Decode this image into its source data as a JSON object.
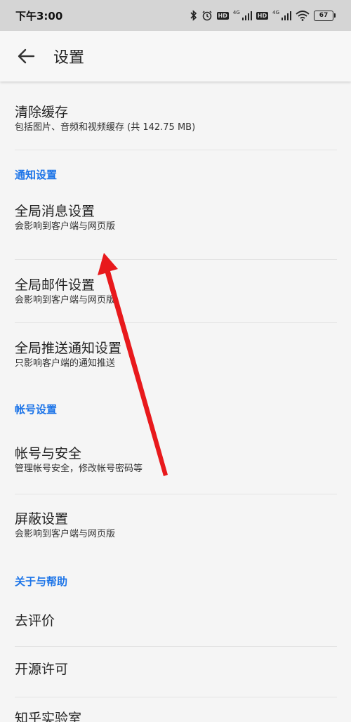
{
  "status_bar": {
    "time": "下午3:00",
    "hd_label": "HD",
    "net_label": "4G",
    "battery": "67"
  },
  "app_bar": {
    "title": "设置",
    "back_icon": "arrow-left-icon"
  },
  "items": {
    "clear_cache": {
      "title": "清除缓存",
      "subtitle": "包括图片、音频和视频缓存 (共 142.75 MB)"
    },
    "global_message": {
      "title": "全局消息设置",
      "subtitle": "会影响到客户端与网页版"
    },
    "global_mail": {
      "title": "全局邮件设置",
      "subtitle": "会影响到客户端与网页版"
    },
    "global_push": {
      "title": "全局推送通知设置",
      "subtitle": "只影响客户端的通知推送"
    },
    "account_security": {
      "title": "帐号与安全",
      "subtitle": "管理帐号安全，修改帐号密码等"
    },
    "block_settings": {
      "title": "屏蔽设置",
      "subtitle": "会影响到客户端与网页版"
    },
    "rate": {
      "title": "去评价"
    },
    "open_source": {
      "title": "开源许可"
    },
    "lab": {
      "title": "知乎实验室"
    }
  },
  "sections": {
    "notification": "通知设置",
    "account": "帐号设置",
    "about": "关于与帮助"
  },
  "colors": {
    "accent": "#1a73e8",
    "annotation_arrow": "#e8191c",
    "background": "#f5f5f5",
    "status_bar": "#d5d5d5"
  }
}
